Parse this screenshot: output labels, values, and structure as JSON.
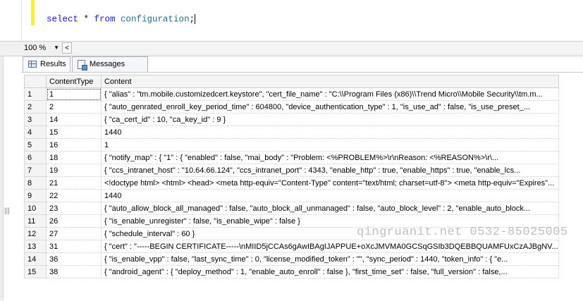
{
  "editor": {
    "query_keyword_select": "select",
    "query_star": " * ",
    "query_keyword_from": "from",
    "query_table": " configuration",
    "query_end": ";"
  },
  "zoom": {
    "value": "100 %",
    "scroll_left_glyph": "<"
  },
  "tabs": [
    {
      "label": "Results",
      "active": true
    },
    {
      "label": "Messages",
      "active": false
    }
  ],
  "results": {
    "columns": [
      "",
      "ContentType",
      "Content"
    ],
    "rows": [
      {
        "num": "1",
        "type": "1",
        "content": "{    \"alias\" : \"tm.mobile.customizedcert.keystore\",    \"cert_file_name\" : \"C:\\\\Program Files (x86)\\\\Trend Micro\\\\Mobile Security\\\\tm.m..."
      },
      {
        "num": "2",
        "type": "2",
        "content": "{    \"auto_genrated_enroll_key_period_time\" : 604800,    \"device_authentication_type\" : 1,    \"is_use_ad\" : false,    \"is_use_preset_..."
      },
      {
        "num": "3",
        "type": "14",
        "content": "{    \"ca_cert_id\" : 10,    \"ca_key_id\" : 9 }"
      },
      {
        "num": "4",
        "type": "15",
        "content": "1440"
      },
      {
        "num": "5",
        "type": "16",
        "content": "1"
      },
      {
        "num": "6",
        "type": "18",
        "content": "{    \"notify_map\" : {       \"1\" : {         \"enabled\" : false,         \"mai_body\" : \"Problem: <%PROBLEM%>\\r\\nReason: <%REASON%>\\r\\..."
      },
      {
        "num": "7",
        "type": "19",
        "content": "{    \"ccs_intranet_host\" : \"10.64.66.124\",    \"ccs_intranet_port\" : 4343,    \"enable_http\" : true,    \"enable_https\" : true,    \"enable_lcs..."
      },
      {
        "num": "8",
        "type": "21",
        "content": "<!doctype html>  <html>  <head>  <meta http-equiv=\"Content-Type\" content=\"text/html; charset=utf-8\">  <meta http-equiv=\"Expires\"..."
      },
      {
        "num": "9",
        "type": "22",
        "content": "1440"
      },
      {
        "num": "10",
        "type": "23",
        "content": "{    \"auto_allow_block_all_managed\" : false,    \"auto_block_all_unmanaged\" : false,    \"auto_block_level\" : 2,    \"enable_auto_block..."
      },
      {
        "num": "11",
        "type": "26",
        "content": "{    \"is_enable_unregister\" : false,    \"is_enable_wipe\" : false }"
      },
      {
        "num": "12",
        "type": "27",
        "content": "{    \"schedule_interval\" : 60 }"
      },
      {
        "num": "13",
        "type": "31",
        "content": "{    \"cert\" : \"-----BEGIN CERTIFICATE-----\\nMIID5jCCAs6gAwIBAgIJAPPUE+oXcJMVMA0GCSqGSIb3DQEBBQUAMFUxCzAJBgNV..."
      },
      {
        "num": "14",
        "type": "36",
        "content": "{    \"is_enable_vpp\" : false,    \"last_sync_time\" : 0,    \"license_modified_token\" : \"\",    \"sync_period\" : 1440,    \"token_info\" : {       \"e..."
      },
      {
        "num": "15",
        "type": "38",
        "content": "{    \"android_agent\" : {       \"deploy_method\" : 1,       \"enable_auto_enroll\" : false    },    \"first_time_set\" : false,    \"full_version\" : false,..."
      }
    ]
  },
  "watermark": "qingruanit.net 0532-85025005",
  "colors": {
    "keyword": "#1a1ad6",
    "identifier": "#1d6f8e",
    "current_line_marker": "#ffef2b"
  }
}
